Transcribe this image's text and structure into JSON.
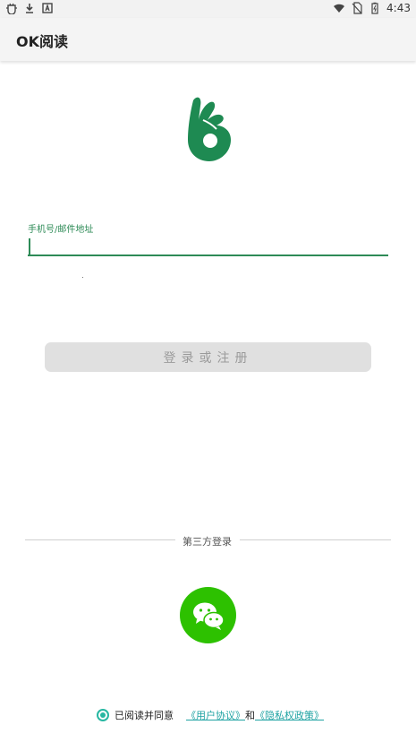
{
  "status_bar": {
    "time": "4:43",
    "left_icons": [
      "bug-icon",
      "download-icon",
      "a-icon"
    ],
    "right_icons": [
      "wifi-icon",
      "no-sim-icon",
      "battery-icon"
    ]
  },
  "app": {
    "title": "OK阅读"
  },
  "form": {
    "field_label": "手机号/邮件地址",
    "field_value": "",
    "login_button_label": "登录或注册"
  },
  "third_party": {
    "label": "第三方登录",
    "wechat_color": "#2dc100"
  },
  "agreement": {
    "text": "已阅读并同意",
    "user_agreement": "《用户协议》",
    "connector": "和",
    "privacy_policy": "《隐私权政策》"
  },
  "colors": {
    "brand_green": "#2e8b57",
    "logo_green": "#1e8a52",
    "link_teal": "#1fa3a3"
  }
}
